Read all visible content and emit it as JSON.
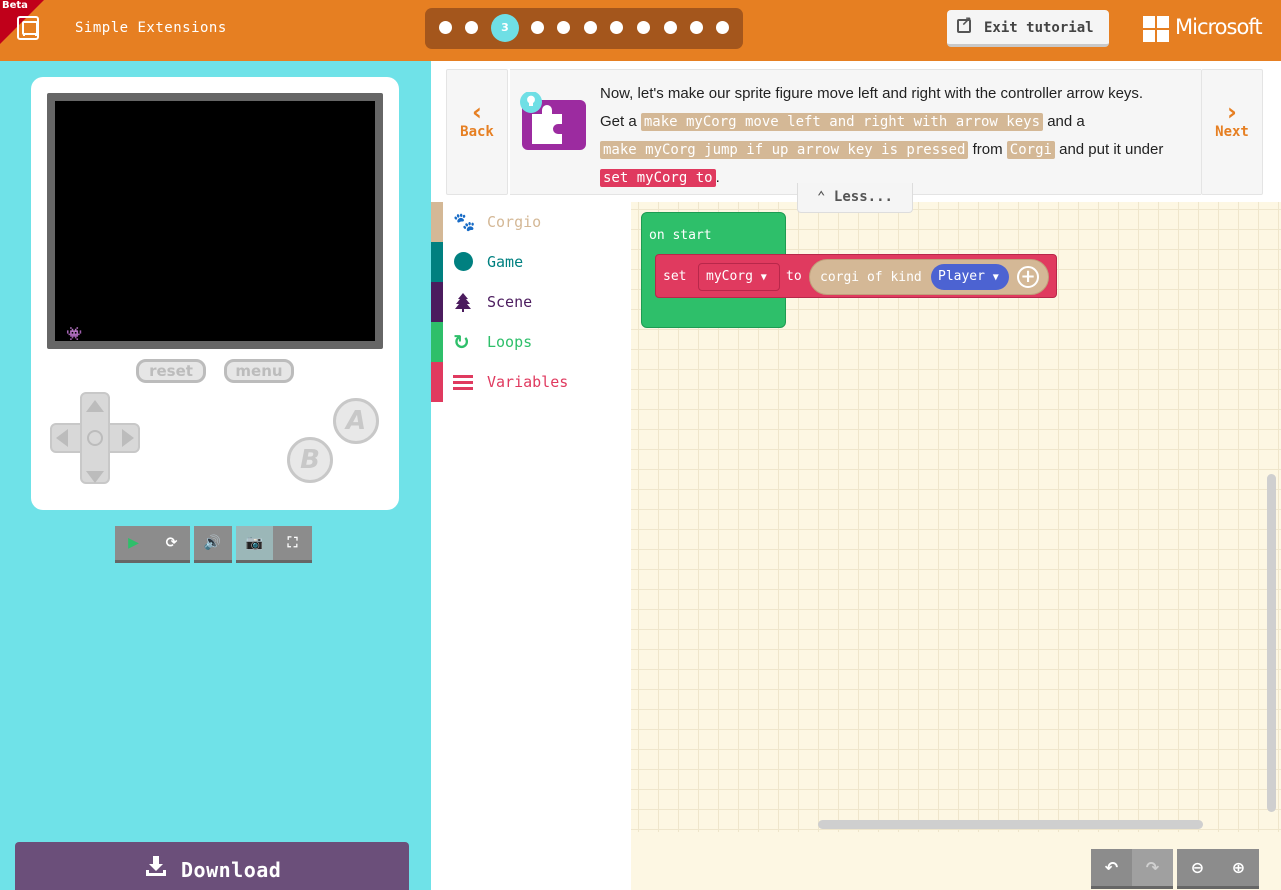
{
  "header": {
    "beta_badge": "Beta",
    "title": "Simple Extensions",
    "steps": [
      {
        "label": ""
      },
      {
        "label": ""
      },
      {
        "label": "3"
      },
      {
        "label": ""
      },
      {
        "label": ""
      },
      {
        "label": ""
      },
      {
        "label": ""
      },
      {
        "label": ""
      },
      {
        "label": ""
      },
      {
        "label": ""
      },
      {
        "label": ""
      }
    ],
    "active_step": 3,
    "exit_label": "Exit tutorial",
    "brand": "Microsoft"
  },
  "simulator": {
    "reset_label": "reset",
    "menu_label": "menu",
    "a_label": "A",
    "b_label": "B",
    "download_label": "Download"
  },
  "tutorial": {
    "back_label": "Back",
    "next_label": "Next",
    "line1": "Now, let's make our sprite figure move left and right with the controller arrow keys.",
    "get_a": "Get a",
    "block1": "make myCorg move left and right with arrow keys",
    "and_a": "and a",
    "block2": "make myCorg jump if up arrow key is pressed",
    "from": "from",
    "block3": "Corgi",
    "put_under": "and put it under",
    "block4": "set myCorg to",
    "period": ".",
    "less_label": "Less..."
  },
  "toolbox": {
    "categories": [
      {
        "label": "Corgio",
        "color": "#d4b896"
      },
      {
        "label": "Game",
        "color": "#008080"
      },
      {
        "label": "Scene",
        "color": "#4b1c5e"
      },
      {
        "label": "Loops",
        "color": "#2ebf6a"
      },
      {
        "label": "Variables",
        "color": "#e03a5f"
      }
    ]
  },
  "workspace": {
    "on_start": "on start",
    "set": "set",
    "variable": "myCorg",
    "to": "to",
    "corgi_of_kind": "corgi of kind",
    "kind": "Player"
  }
}
